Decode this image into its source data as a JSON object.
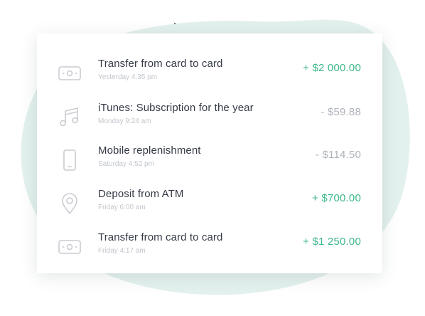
{
  "colors": {
    "background_blob": "#e3f1ee",
    "positive": "#3cb889",
    "negative": "#aeb2b9",
    "title": "#363b47",
    "time": "#c2c6cc",
    "icon_stroke": "#c9ccd1"
  },
  "transactions": [
    {
      "icon": "cash-icon",
      "title": "Transfer from card to card",
      "time": "Yesterday 4:35 pm",
      "amount": "+ $2 000.00",
      "direction": "positive"
    },
    {
      "icon": "music-note-icon",
      "title": "iTunes: Subscription for the year",
      "time": "Monday 9:24 am",
      "amount": "- $59.88",
      "direction": "negative"
    },
    {
      "icon": "mobile-phone-icon",
      "title": "Mobile replenishment",
      "time": "Saturday 4:52 pm",
      "amount": "- $114.50",
      "direction": "negative"
    },
    {
      "icon": "location-pin-icon",
      "title": "Deposit from ATM",
      "time": "Friday 6:00 am",
      "amount": "+ $700.00",
      "direction": "positive"
    },
    {
      "icon": "cash-icon",
      "title": "Transfer from card to card",
      "time": "Friday 4:17 am",
      "amount": "+ $1 250.00",
      "direction": "positive"
    }
  ]
}
